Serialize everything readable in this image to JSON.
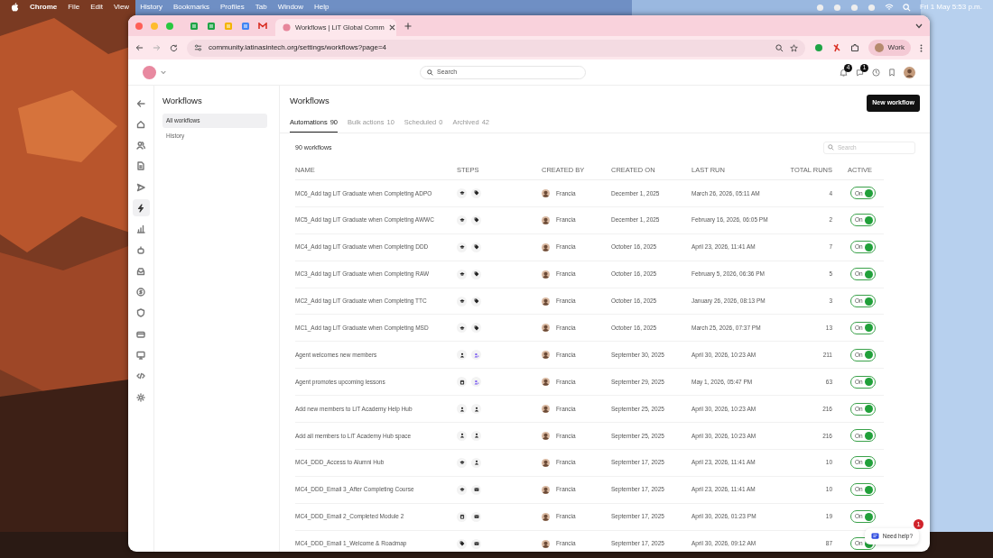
{
  "menubar": {
    "app": "Chrome",
    "menus": [
      "File",
      "Edit",
      "View",
      "History",
      "Bookmarks",
      "Profiles",
      "Tab",
      "Window",
      "Help"
    ],
    "clock": "Fri 1 May  5:53 p.m."
  },
  "browser": {
    "tab_title": "Workflows | LiT Global Comm",
    "url": "community.latinasintech.org/settings/workflows?page=4",
    "profile": "Work"
  },
  "header": {
    "search_placeholder": "Search",
    "badges": [
      "4",
      "1"
    ]
  },
  "rail": [
    {
      "kind": "back",
      "selected": false
    },
    {
      "kind": "home",
      "selected": false
    },
    {
      "kind": "members",
      "selected": false
    },
    {
      "kind": "page",
      "selected": false
    },
    {
      "kind": "send",
      "selected": false
    },
    {
      "kind": "bolt",
      "selected": true
    },
    {
      "kind": "chart",
      "selected": false
    },
    {
      "kind": "bot",
      "selected": false
    },
    {
      "kind": "inbox",
      "selected": false
    },
    {
      "kind": "coin",
      "selected": false
    },
    {
      "kind": "badge",
      "selected": false
    },
    {
      "kind": "card",
      "selected": false
    },
    {
      "kind": "monitor",
      "selected": false
    },
    {
      "kind": "code",
      "selected": false
    },
    {
      "kind": "gear",
      "selected": false
    }
  ],
  "sidebar": {
    "title": "Workflows",
    "items": [
      {
        "label": "All workflows",
        "selected": true
      },
      {
        "label": "History",
        "selected": false
      }
    ]
  },
  "main": {
    "title": "Workflows",
    "new_button": "New workflow",
    "tabs": [
      {
        "label": "Automations",
        "count": "90",
        "selected": true
      },
      {
        "label": "Bulk actions",
        "count": "10",
        "selected": false
      },
      {
        "label": "Scheduled",
        "count": "0",
        "selected": false
      },
      {
        "label": "Archived",
        "count": "42",
        "selected": false
      }
    ],
    "count_label": "90 workflows",
    "search_placeholder": "Search",
    "columns": [
      "NAME",
      "STEPS",
      "CREATED BY",
      "CREATED ON",
      "LAST RUN",
      "TOTAL RUNS",
      "ACTIVE"
    ],
    "rows": [
      {
        "name": "MC6_Add tag LiT Graduate when Completing ADPO",
        "steps": [
          {
            "kind": "course"
          },
          {
            "kind": "tag"
          }
        ],
        "created_by": "Francia",
        "created_on": "December 1, 2025",
        "last_run": "March 26, 2026, 05:11 AM",
        "total_runs": "4",
        "active": true,
        "toggle_label": "On"
      },
      {
        "name": "MC5_Add tag LiT Graduate when Completing AWWC",
        "steps": [
          {
            "kind": "course"
          },
          {
            "kind": "tag"
          }
        ],
        "created_by": "Francia",
        "created_on": "December 1, 2025",
        "last_run": "February 16, 2026, 06:05 PM",
        "total_runs": "2",
        "active": true,
        "toggle_label": "On"
      },
      {
        "name": "MC4_Add tag LiT Graduate when Completing DDD",
        "steps": [
          {
            "kind": "course"
          },
          {
            "kind": "tag"
          }
        ],
        "created_by": "Francia",
        "created_on": "October 16, 2025",
        "last_run": "April 23, 2026, 11:41 AM",
        "total_runs": "7",
        "active": true,
        "toggle_label": "On"
      },
      {
        "name": "MC3_Add tag LiT Graduate when Completing RAW",
        "steps": [
          {
            "kind": "course"
          },
          {
            "kind": "tag"
          }
        ],
        "created_by": "Francia",
        "created_on": "October 16, 2025",
        "last_run": "February 5, 2026, 06:36 PM",
        "total_runs": "5",
        "active": true,
        "toggle_label": "On"
      },
      {
        "name": "MC2_Add tag LiT Graduate when Completing TTC",
        "steps": [
          {
            "kind": "course"
          },
          {
            "kind": "tag"
          }
        ],
        "created_by": "Francia",
        "created_on": "October 16, 2025",
        "last_run": "January 26, 2026, 08:13 PM",
        "total_runs": "3",
        "active": true,
        "toggle_label": "On"
      },
      {
        "name": "MC1_Add tag LiT Graduate when Completing MSD",
        "steps": [
          {
            "kind": "course"
          },
          {
            "kind": "tag"
          }
        ],
        "created_by": "Francia",
        "created_on": "October 16, 2025",
        "last_run": "March 25, 2026, 07:37 PM",
        "total_runs": "13",
        "active": true,
        "toggle_label": "On"
      },
      {
        "name": "Agent welcomes new members",
        "steps": [
          {
            "kind": "member"
          },
          {
            "kind": "agent"
          }
        ],
        "created_by": "Francia",
        "created_on": "September 30, 2025",
        "last_run": "April 30, 2026, 10:23 AM",
        "total_runs": "211",
        "active": true,
        "toggle_label": "On"
      },
      {
        "name": "Agent promotes upcoming lessons",
        "steps": [
          {
            "kind": "event"
          },
          {
            "kind": "agent"
          }
        ],
        "created_by": "Francia",
        "created_on": "September 29, 2025",
        "last_run": "May 1, 2026, 05:47 PM",
        "total_runs": "63",
        "active": true,
        "toggle_label": "On"
      },
      {
        "name": "Add new members to LiT Academy Help Hub",
        "steps": [
          {
            "kind": "member"
          },
          {
            "kind": "member"
          }
        ],
        "created_by": "Francia",
        "created_on": "September 25, 2025",
        "last_run": "April 30, 2026, 10:23 AM",
        "total_runs": "216",
        "active": true,
        "toggle_label": "On"
      },
      {
        "name": "Add all members to LiT Academy Hub space",
        "steps": [
          {
            "kind": "member"
          },
          {
            "kind": "member"
          }
        ],
        "created_by": "Francia",
        "created_on": "September 25, 2025",
        "last_run": "April 30, 2026, 10:23 AM",
        "total_runs": "216",
        "active": true,
        "toggle_label": "On"
      },
      {
        "name": "MC4_DDD_Access to Alumni Hub",
        "steps": [
          {
            "kind": "course"
          },
          {
            "kind": "member"
          }
        ],
        "created_by": "Francia",
        "created_on": "September 17, 2025",
        "last_run": "April 23, 2026, 11:41 AM",
        "total_runs": "10",
        "active": true,
        "toggle_label": "On"
      },
      {
        "name": "MC4_DDD_Email 3_After Completing Course",
        "steps": [
          {
            "kind": "course"
          },
          {
            "kind": "email"
          }
        ],
        "created_by": "Francia",
        "created_on": "September 17, 2025",
        "last_run": "April 23, 2026, 11:41 AM",
        "total_runs": "10",
        "active": true,
        "toggle_label": "On"
      },
      {
        "name": "MC4_DDD_Email 2_Completed Module 2",
        "steps": [
          {
            "kind": "event"
          },
          {
            "kind": "email"
          }
        ],
        "created_by": "Francia",
        "created_on": "September 17, 2025",
        "last_run": "April 30, 2026, 01:23 PM",
        "total_runs": "19",
        "active": true,
        "toggle_label": "On"
      },
      {
        "name": "MC4_DDD_Email 1_Welcome & Roadmap",
        "steps": [
          {
            "kind": "tag"
          },
          {
            "kind": "email"
          }
        ],
        "created_by": "Francia",
        "created_on": "September 17, 2025",
        "last_run": "April 30, 2026, 09:12 AM",
        "total_runs": "87",
        "active": true,
        "toggle_label": "On"
      }
    ]
  },
  "help": {
    "label": "Need help?",
    "badge": "1"
  }
}
